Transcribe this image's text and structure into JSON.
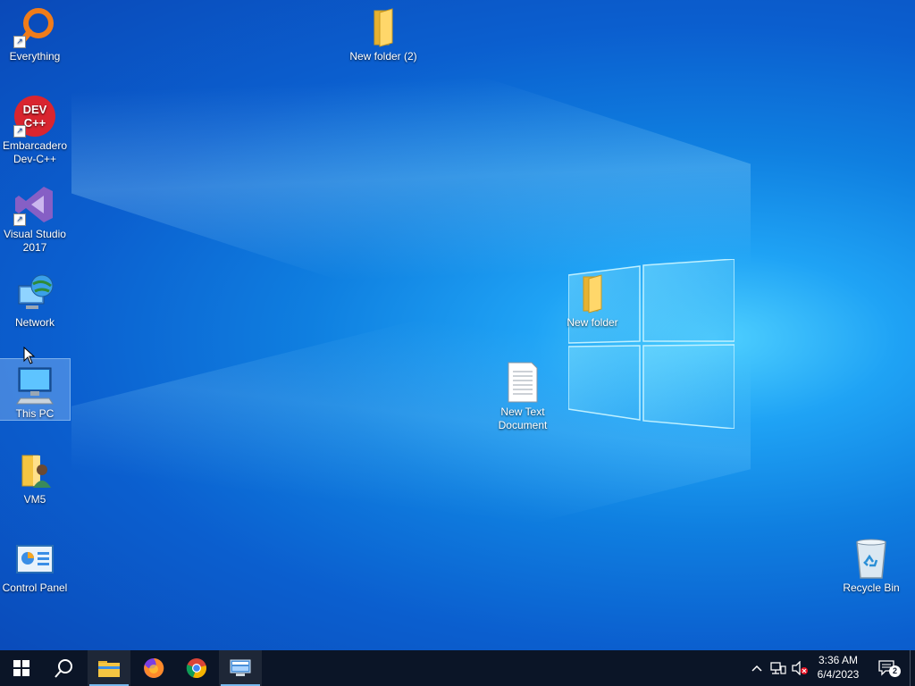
{
  "desktop_icons": [
    {
      "label": "Everything"
    },
    {
      "label": "Embarcadero Dev-C++"
    },
    {
      "label": "Visual Studio 2017"
    },
    {
      "label": "Network"
    },
    {
      "label": "This PC"
    },
    {
      "label": "VM5"
    },
    {
      "label": "Control Panel"
    },
    {
      "label": "New folder (2)"
    },
    {
      "label": "New folder"
    },
    {
      "label": "New Text Document"
    },
    {
      "label": "Recycle Bin"
    }
  ],
  "dev_icon_text": {
    "line1": "DEV",
    "line2": "C++"
  },
  "taskbar": {
    "pinned": [
      "start-icon",
      "search-icon",
      "file-explorer-icon",
      "firefox-icon",
      "chrome-icon",
      "remote-desktop-icon"
    ]
  },
  "tray": {
    "time": "3:36 AM",
    "date": "6/4/2023",
    "notification_count": "2"
  },
  "colors": {
    "taskbar": "#0b1527",
    "accent": "#76b9ed",
    "folder": "#f5c542"
  }
}
